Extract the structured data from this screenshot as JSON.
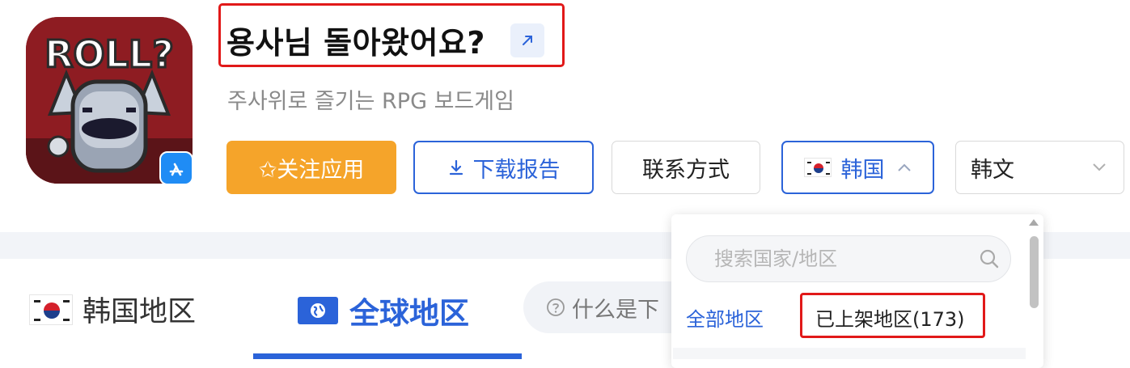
{
  "app": {
    "title": "용사님 돌아왔어요?",
    "subtitle": "주사위로 즐기는 RPG 보드게임",
    "icon_text": "ROLL?",
    "store_badge_icon": "app-store-icon",
    "external_link_icon": "arrow-up-right-icon"
  },
  "actions": {
    "follow_label": "✩关注应用",
    "download_label": "下载报告",
    "contact_label": "联系方式",
    "country_label": "韩国",
    "language_label": "韩文"
  },
  "tabs": {
    "korea_label": "韩国地区",
    "global_label": "全球地区",
    "help_text": "什么是下"
  },
  "country_dropdown": {
    "search_placeholder": "搜索国家/地区",
    "all_label": "全部地区",
    "listed_label": "已上架地区(173)"
  },
  "colors": {
    "accent": "#2b63d9",
    "follow": "#f5a42a",
    "highlight": "#e11919"
  }
}
